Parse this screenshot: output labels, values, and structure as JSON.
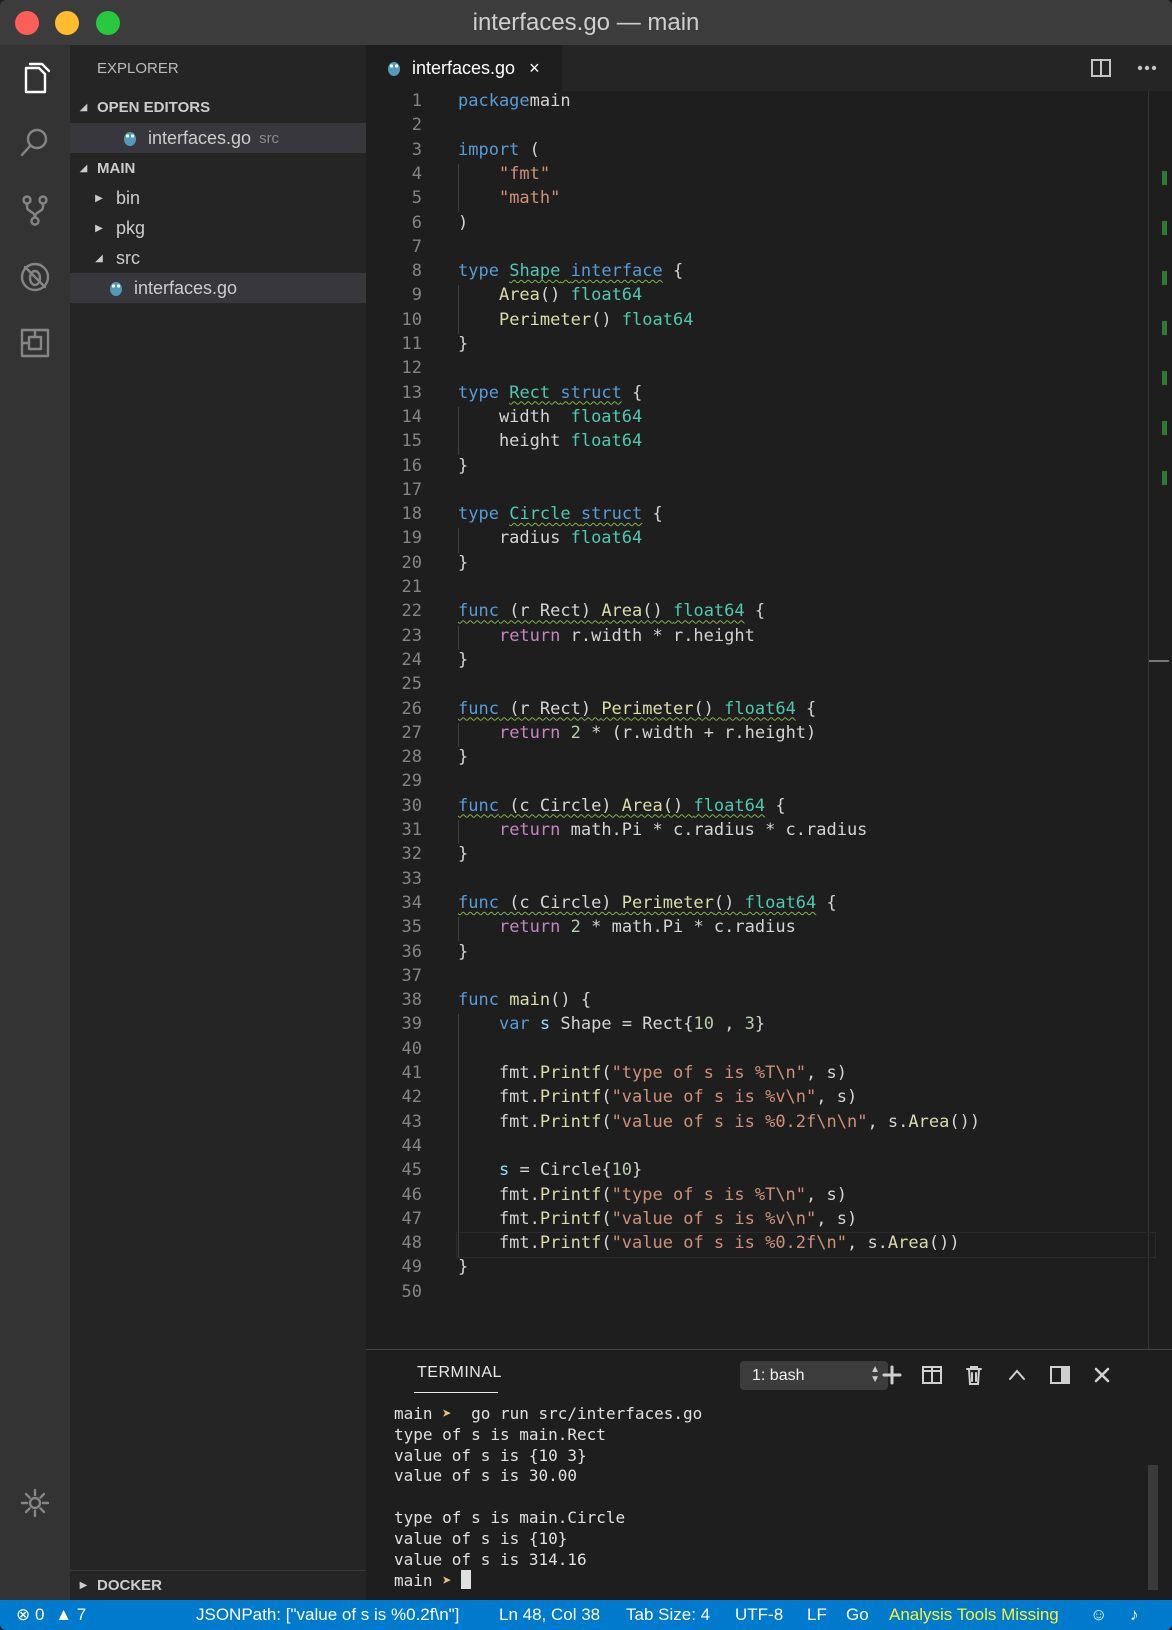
{
  "window": {
    "title": "interfaces.go — main"
  },
  "sidebar": {
    "title": "EXPLORER",
    "open_editors_label": "OPEN EDITORS",
    "open_editor_file": "interfaces.go",
    "open_editor_folder": "src",
    "main_label": "MAIN",
    "tree": [
      {
        "label": "bin"
      },
      {
        "label": "pkg"
      },
      {
        "label": "src"
      },
      {
        "label": "interfaces.go"
      }
    ],
    "docker_label": "DOCKER"
  },
  "editor": {
    "tab_label": "interfaces.go",
    "close_glyph": "×",
    "lines": [
      [
        [
          "kw",
          "package"
        ],
        [
          "",
          "main"
        ]
      ],
      [],
      [
        [
          "kw",
          "import"
        ],
        [
          "",
          " ("
        ]
      ],
      [
        [
          "",
          "    "
        ],
        [
          "str",
          "\"fmt\""
        ]
      ],
      [
        [
          "",
          "    "
        ],
        [
          "str",
          "\"math\""
        ]
      ],
      [
        [
          "",
          ")"
        ]
      ],
      [],
      [
        [
          "kw",
          "type"
        ],
        [
          "",
          " "
        ],
        [
          "ty sq",
          "Shape"
        ],
        [
          "sq",
          " "
        ],
        [
          "kw sq",
          "interface"
        ],
        [
          "",
          " {"
        ]
      ],
      [
        [
          "",
          "    "
        ],
        [
          "fn",
          "Area"
        ],
        [
          "",
          "() "
        ],
        [
          "ty",
          "float64"
        ]
      ],
      [
        [
          "",
          "    "
        ],
        [
          "fn",
          "Perimeter"
        ],
        [
          "",
          "() "
        ],
        [
          "ty",
          "float64"
        ]
      ],
      [
        [
          "",
          "}"
        ]
      ],
      [],
      [
        [
          "kw",
          "type"
        ],
        [
          "",
          " "
        ],
        [
          "ty sq",
          "Rect"
        ],
        [
          "sq",
          " "
        ],
        [
          "kw sq",
          "struct"
        ],
        [
          "",
          " {"
        ]
      ],
      [
        [
          "",
          "    width  "
        ],
        [
          "ty",
          "float64"
        ]
      ],
      [
        [
          "",
          "    height "
        ],
        [
          "ty",
          "float64"
        ]
      ],
      [
        [
          "",
          "}"
        ]
      ],
      [],
      [
        [
          "kw",
          "type"
        ],
        [
          "",
          " "
        ],
        [
          "ty sq",
          "Circle"
        ],
        [
          "sq",
          " "
        ],
        [
          "kw sq",
          "struct"
        ],
        [
          "",
          " {"
        ]
      ],
      [
        [
          "",
          "    radius "
        ],
        [
          "ty",
          "float64"
        ]
      ],
      [
        [
          "",
          "}"
        ]
      ],
      [],
      [
        [
          "kw sq",
          "func"
        ],
        [
          "sq",
          " (r Rect) "
        ],
        [
          "fn sq",
          "Area"
        ],
        [
          "sq",
          "() "
        ],
        [
          "ty sq",
          "float64"
        ],
        [
          "",
          " {"
        ]
      ],
      [
        [
          "",
          "    "
        ],
        [
          "ctl",
          "return"
        ],
        [
          "",
          " r.width * r.height"
        ]
      ],
      [
        [
          "",
          "}"
        ]
      ],
      [],
      [
        [
          "kw sq",
          "func"
        ],
        [
          "sq",
          " (r Rect) "
        ],
        [
          "fn sq",
          "Perimeter"
        ],
        [
          "sq",
          "() "
        ],
        [
          "ty sq",
          "float64"
        ],
        [
          "",
          " {"
        ]
      ],
      [
        [
          "",
          "    "
        ],
        [
          "ctl",
          "return"
        ],
        [
          "",
          " "
        ],
        [
          "num",
          "2"
        ],
        [
          "",
          " * (r.width + r.height)"
        ]
      ],
      [
        [
          "",
          "}"
        ]
      ],
      [],
      [
        [
          "kw sq",
          "func"
        ],
        [
          "sq",
          " (c Circle) "
        ],
        [
          "fn sq",
          "Area"
        ],
        [
          "sq",
          "() "
        ],
        [
          "ty sq",
          "float64"
        ],
        [
          "",
          " {"
        ]
      ],
      [
        [
          "",
          "    "
        ],
        [
          "ctl",
          "return"
        ],
        [
          "",
          " math.Pi * c.radius * c.radius"
        ]
      ],
      [
        [
          "",
          "}"
        ]
      ],
      [],
      [
        [
          "kw sq",
          "func"
        ],
        [
          "sq",
          " (c Circle) "
        ],
        [
          "fn sq",
          "Perimeter"
        ],
        [
          "sq",
          "() "
        ],
        [
          "ty sq",
          "float64"
        ],
        [
          "",
          " {"
        ]
      ],
      [
        [
          "",
          "    "
        ],
        [
          "ctl",
          "return"
        ],
        [
          "",
          " "
        ],
        [
          "num",
          "2"
        ],
        [
          "",
          " * math.Pi * c.radius"
        ]
      ],
      [
        [
          "",
          "}"
        ]
      ],
      [],
      [
        [
          "kw",
          "func"
        ],
        [
          "",
          " "
        ],
        [
          "fn",
          "main"
        ],
        [
          "",
          "() {"
        ]
      ],
      [
        [
          "",
          "    "
        ],
        [
          "kw",
          "var"
        ],
        [
          "",
          " "
        ],
        [
          "var",
          "s"
        ],
        [
          "",
          " Shape = Rect{"
        ],
        [
          "num",
          "10"
        ],
        [
          "",
          " ,"
        ],
        [
          "num",
          " 3"
        ],
        [
          "",
          "}"
        ]
      ],
      [],
      [
        [
          "",
          "    fmt."
        ],
        [
          "fn",
          "Printf"
        ],
        [
          "",
          "("
        ],
        [
          "str",
          "\"type of s is %T\\n\""
        ],
        [
          "",
          ", s)"
        ]
      ],
      [
        [
          "",
          "    fmt."
        ],
        [
          "fn",
          "Printf"
        ],
        [
          "",
          "("
        ],
        [
          "str",
          "\"value of s is %v\\n\""
        ],
        [
          "",
          ", s)"
        ]
      ],
      [
        [
          "",
          "    fmt."
        ],
        [
          "fn",
          "Printf"
        ],
        [
          "",
          "("
        ],
        [
          "str",
          "\"value of s is %0.2f\\n\\n\""
        ],
        [
          "",
          ", s."
        ],
        [
          "fn",
          "Area"
        ],
        [
          "",
          "())"
        ]
      ],
      [],
      [
        [
          "",
          "    "
        ],
        [
          "var",
          "s"
        ],
        [
          "",
          " = Circle{"
        ],
        [
          "num",
          "10"
        ],
        [
          "",
          "}"
        ]
      ],
      [
        [
          "",
          "    fmt."
        ],
        [
          "fn",
          "Printf"
        ],
        [
          "",
          "("
        ],
        [
          "str",
          "\"type of s is %T\\n\""
        ],
        [
          "",
          ", s)"
        ]
      ],
      [
        [
          "",
          "    fmt."
        ],
        [
          "fn",
          "Printf"
        ],
        [
          "",
          "("
        ],
        [
          "str",
          "\"value of s is %v\\n\""
        ],
        [
          "",
          ", s)"
        ]
      ],
      [
        [
          "",
          "    fmt."
        ],
        [
          "fn",
          "Printf"
        ],
        [
          "",
          "("
        ],
        [
          "str",
          "\"value of s is %0.2f\\n\""
        ],
        [
          "",
          ", s."
        ],
        [
          "fn",
          "Area"
        ],
        [
          "",
          "())"
        ]
      ],
      [
        [
          "",
          "}"
        ]
      ],
      []
    ]
  },
  "terminal": {
    "tab_label": "TERMINAL",
    "shell_select": "1: bash",
    "lines": [
      {
        "prompt": "main",
        "arrow": "➤",
        "text": "  go run src/interfaces.go"
      },
      {
        "text": "type of s is main.Rect"
      },
      {
        "text": "value of s is {10 3}"
      },
      {
        "text": "value of s is 30.00"
      },
      {
        "text": ""
      },
      {
        "text": "type of s is main.Circle"
      },
      {
        "text": "value of s is {10}"
      },
      {
        "text": "value of s is 314.16"
      },
      {
        "prompt": "main",
        "arrow": "➤",
        "text": " ",
        "cursor": true
      }
    ]
  },
  "statusbar": {
    "errors": "0",
    "warnings": "7",
    "jsonpath": "JSONPath: [\"value of s is %0.2f\\n\"]",
    "position": "Ln 48, Col 38",
    "tab_size": "Tab Size: 4",
    "encoding": "UTF-8",
    "eol": "LF",
    "language": "Go",
    "analysis": "Analysis Tools Missing"
  },
  "colors": {
    "statusbar": "#007acc",
    "activity_bar": "#333333",
    "sidebar": "#252526",
    "editor": "#1e1e1e",
    "warning_text": "#f8f23a"
  }
}
